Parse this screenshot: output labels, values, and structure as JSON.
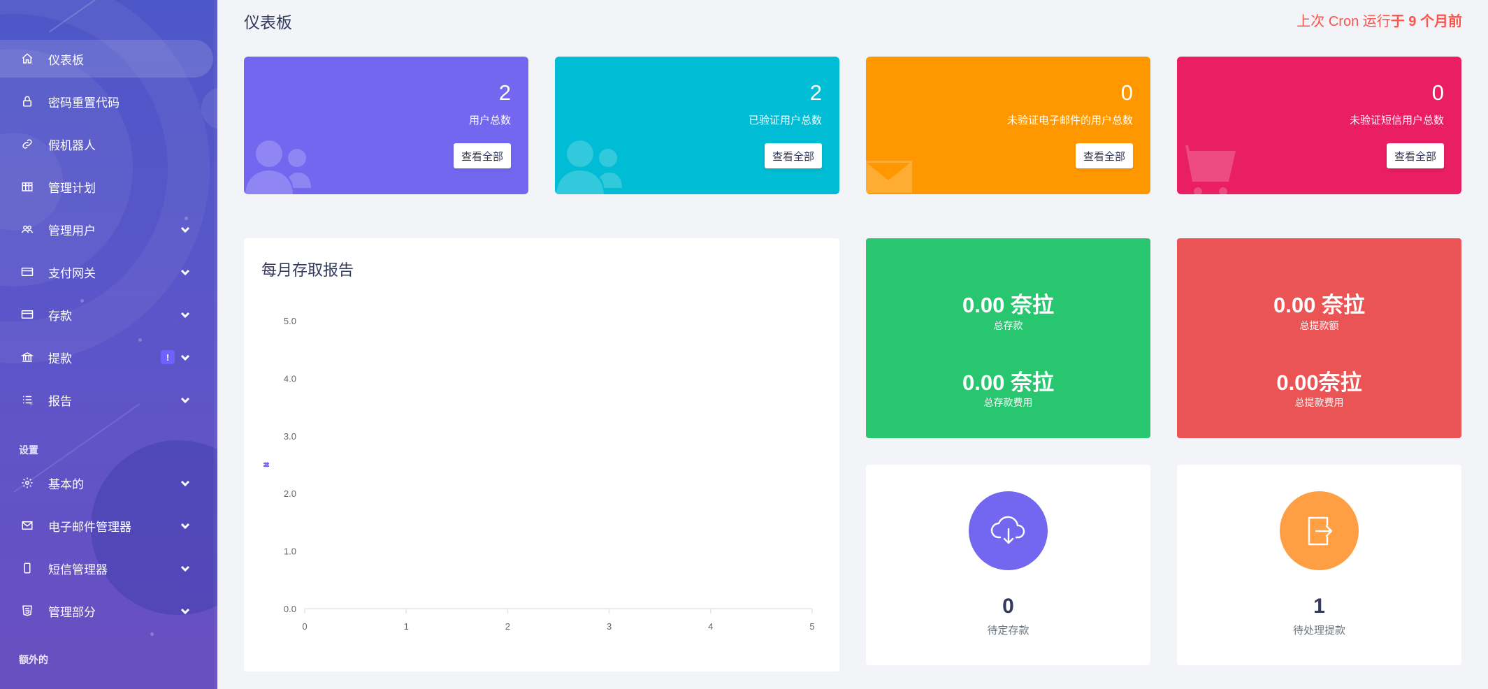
{
  "sidebar": {
    "items": [
      {
        "label": "仪表板",
        "icon": "home-icon",
        "active": true
      },
      {
        "label": "密码重置代码",
        "icon": "lock-icon"
      },
      {
        "label": "假机器人",
        "icon": "link-icon"
      },
      {
        "label": "管理计划",
        "icon": "building-icon"
      },
      {
        "label": "管理用户",
        "icon": "users-icon"
      },
      {
        "label": "支付网关",
        "icon": "credit-card-icon"
      },
      {
        "label": "存款",
        "icon": "credit-card-icon"
      },
      {
        "label": "提款",
        "icon": "bank-icon",
        "badge": "!"
      },
      {
        "label": "报告",
        "icon": "list-icon"
      }
    ],
    "section_settings": "设置",
    "settings_items": [
      {
        "label": "基本的",
        "icon": "gear-icon"
      },
      {
        "label": "电子邮件管理器",
        "icon": "envelope-icon"
      },
      {
        "label": "短信管理器",
        "icon": "mobile-icon"
      },
      {
        "label": "管理部分",
        "icon": "html5-icon"
      }
    ],
    "section_extra": "额外的"
  },
  "header": {
    "title": "仪表板",
    "cron_prefix": "上次 Cron 运行",
    "cron_emphasis": "于 9 个月前"
  },
  "stats": [
    {
      "value": "2",
      "label": "用户总数",
      "button": "查看全部",
      "color": "#7367f0",
      "icon": "users-icon"
    },
    {
      "value": "2",
      "label": "已验证用户总数",
      "button": "查看全部",
      "color": "#00bcd4",
      "icon": "users-icon"
    },
    {
      "value": "0",
      "label": "未验证电子邮件的用户总数",
      "button": "查看全部",
      "color": "#ff9800",
      "icon": "envelope-icon"
    },
    {
      "value": "0",
      "label": "未验证短信用户总数",
      "button": "查看全部",
      "color": "#e91e63",
      "icon": "cart-icon"
    }
  ],
  "money": {
    "deposit": {
      "total_amount": "0.00 奈拉",
      "total_label": "总存款",
      "fee_amount": "0.00 奈拉",
      "fee_label": "总存款费用",
      "color": "#28c76f"
    },
    "withdraw": {
      "total_amount": "0.00 奈拉",
      "total_label": "总提款额",
      "fee_amount": "0.00奈拉",
      "fee_label": "总提款费用",
      "color": "#ea5455"
    }
  },
  "pending": {
    "deposit": {
      "value": "0",
      "label": "待定存款",
      "color": "#7367f0",
      "icon": "cloud-download-icon"
    },
    "withdraw": {
      "value": "1",
      "label": "待处理提款",
      "color": "#ff9f43",
      "icon": "sign-out-icon"
    }
  },
  "chart_data": {
    "type": "line",
    "title": "每月存取报告",
    "ylabel": "₦",
    "x": [
      0,
      1,
      2,
      3,
      4,
      5
    ],
    "y_ticks": [
      "0.0",
      "1.0",
      "2.0",
      "3.0",
      "4.0",
      "5.0"
    ],
    "x_ticks": [
      "0",
      "1",
      "2",
      "3",
      "4",
      "5"
    ],
    "xlim": [
      0,
      5
    ],
    "ylim": [
      0,
      5
    ],
    "series": [],
    "grid": false
  }
}
